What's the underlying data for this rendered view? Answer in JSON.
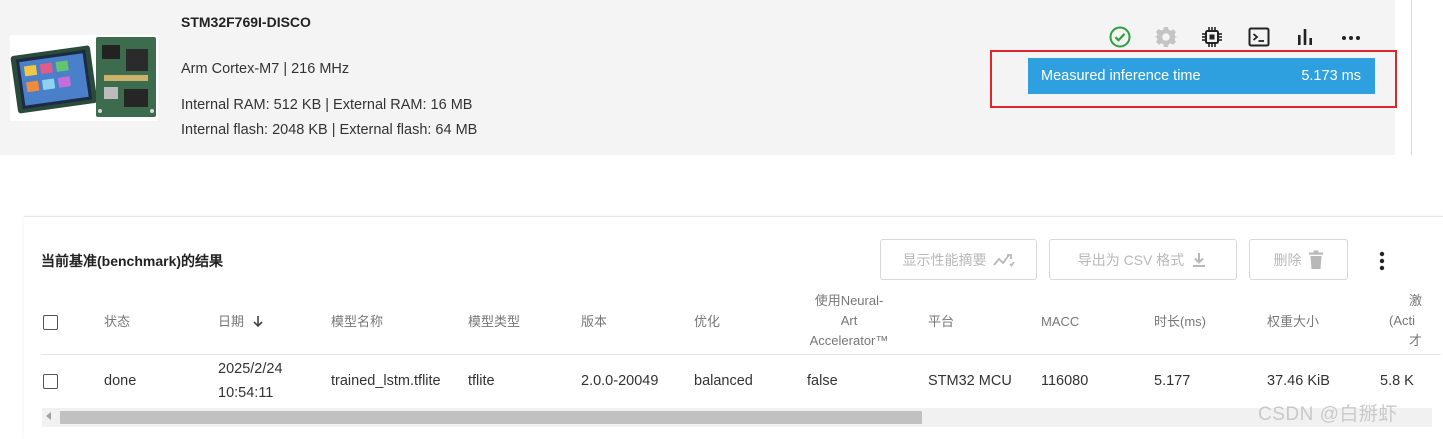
{
  "board": {
    "name": "STM32F769I-DISCO",
    "cpu": "Arm Cortex-M7 | 216 MHz",
    "ram": "Internal RAM: 512 KB | External RAM: 16 MB",
    "flash": "Internal flash: 2048 KB | External flash: 64 MB",
    "image_icon": "board-photo",
    "toolbar_icons": [
      "check-circle-icon",
      "gear-icon",
      "chip-icon",
      "terminal-icon",
      "bar-chart-icon",
      "more-horizontal-icon"
    ],
    "status_color": "#2e9e3e",
    "accent": "#2ea0df",
    "highlight_color": "#e0262c"
  },
  "inference": {
    "label": "Measured inference time",
    "value": "5.173 ms"
  },
  "results": {
    "title": "当前基准(benchmark)的结果",
    "actions": {
      "summary": "显示性能摘要",
      "export": "导出为 CSV 格式",
      "delete": "删除"
    },
    "columns": {
      "status": "状态",
      "date": "日期",
      "model_name": "模型名称",
      "model_type": "模型类型",
      "version": "版本",
      "optimization": "优化",
      "npu_line1": "使用Neural-",
      "npu_line2": "Art",
      "npu_line3": "Accelerator™",
      "platform": "平台",
      "macc": "MACC",
      "duration": "时长(ms)",
      "weights": "权重大小",
      "act_line1": "激",
      "act_line2": "(Acti",
      "act_line3": "才"
    },
    "rows": [
      {
        "status": "done",
        "date_line1": "2025/2/24",
        "date_line2": "10:54:11",
        "model_name": "trained_lstm.tflite",
        "model_type": "tflite",
        "version": "2.0.0-20049",
        "optimization": "balanced",
        "npu": "false",
        "platform": "STM32 MCU",
        "macc": "116080",
        "duration": "5.177",
        "weights": "37.46 KiB",
        "activations": "5.8 K"
      }
    ]
  },
  "scroll_position": 0.0,
  "scroll_visible_fraction": 0.62,
  "watermark": "CSDN @白掰虾"
}
